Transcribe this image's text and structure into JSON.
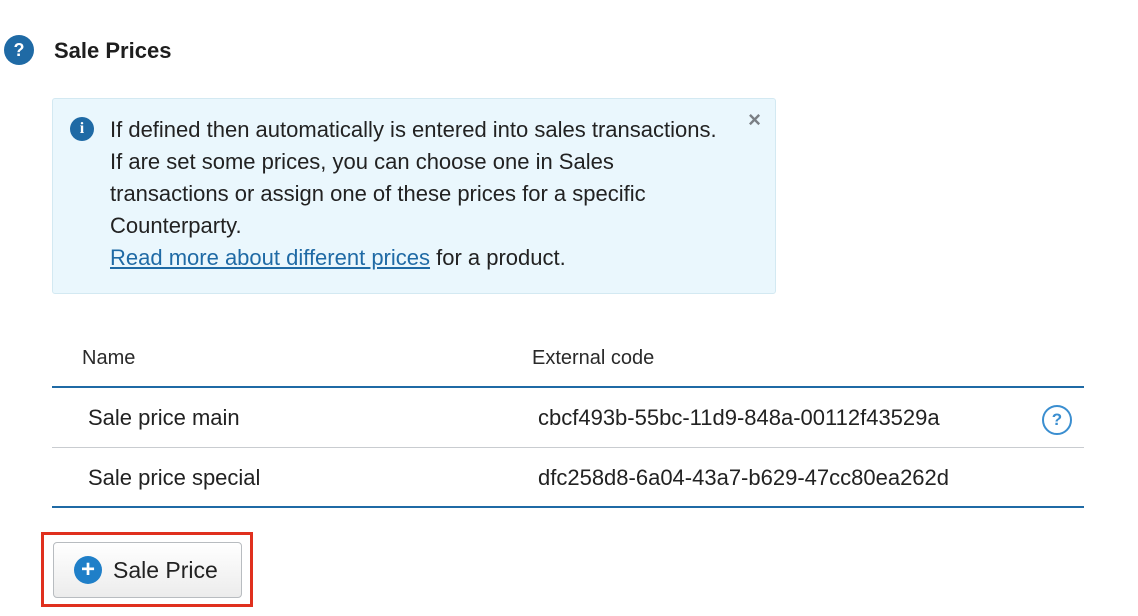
{
  "section": {
    "title": "Sale Prices",
    "help_icon_glyph": "?"
  },
  "info_box": {
    "icon_glyph": "i",
    "text": "If defined then automatically is entered into sales transactions. If are set some prices, you can choose one in Sales transactions or assign one of these prices for a specific Counterparty.",
    "link_text": "Read more about different prices",
    "link_suffix": " for a product.",
    "close_glyph": "×"
  },
  "table": {
    "columns": {
      "name": "Name",
      "external_code": "External code"
    },
    "rows": [
      {
        "name": "Sale price main",
        "external_code": "cbcf493b-55bc-11d9-848a-00112f43529a",
        "help_glyph": "?"
      },
      {
        "name": "Sale price special",
        "external_code": "dfc258d8-6a04-43a7-b629-47cc80ea262d"
      }
    ]
  },
  "add_button": {
    "icon_glyph": "+",
    "label": "Sale Price"
  },
  "colors": {
    "accent": "#1f6aa5",
    "info_background": "#eaf7fd",
    "highlight": "#e0301e"
  }
}
